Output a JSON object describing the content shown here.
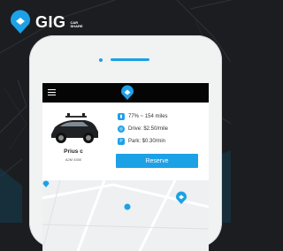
{
  "brand": {
    "name": "GIG",
    "sub_line1": "CAR",
    "sub_line2": "SHARE"
  },
  "vehicle": {
    "name": "Prius c",
    "plate": "A2M 4350"
  },
  "stats": {
    "battery": "77% ~ 154 miles",
    "drive": "Drive: $2.50/mile",
    "park": "Park: $0.30/min"
  },
  "actions": {
    "reserve_label": "Reserve"
  },
  "icons": {
    "menu": "hamburger-menu-icon",
    "logo_pin": "gig-pin-icon",
    "battery": "battery-icon",
    "drive": "steering-wheel-icon",
    "park": "parking-icon"
  },
  "colors": {
    "accent": "#1da1e6",
    "topbar": "#050505",
    "background": "#1b1d20"
  }
}
